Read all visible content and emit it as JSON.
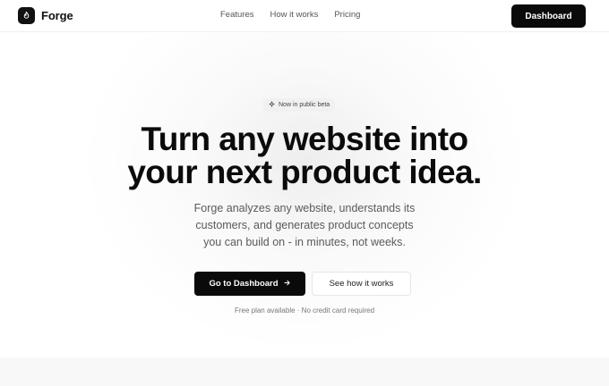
{
  "brand": {
    "name": "Forge",
    "logo_icon": "flame-icon"
  },
  "nav": {
    "links": [
      "Features",
      "How it works",
      "Pricing"
    ],
    "dashboard_label": "Dashboard"
  },
  "hero": {
    "badge": {
      "icon": "sparkle-icon",
      "label": "Now in public beta"
    },
    "headline_line1": "Turn any website into",
    "headline_line2": "your next product idea.",
    "subtitle_line1": "Forge analyzes any website, understands its",
    "subtitle_line2": "customers, and generates product concepts",
    "subtitle_line3": "you can build on - in minutes, not weeks.",
    "primary_cta": {
      "label": "Go to Dashboard",
      "icon": "arrow-right-icon"
    },
    "secondary_cta": {
      "label": "See how it works"
    },
    "note": "Free plan available · No credit card required"
  },
  "colors": {
    "primary": "#0a0a0a",
    "muted_text": "#5a5a5a",
    "background": "#ffffff"
  }
}
